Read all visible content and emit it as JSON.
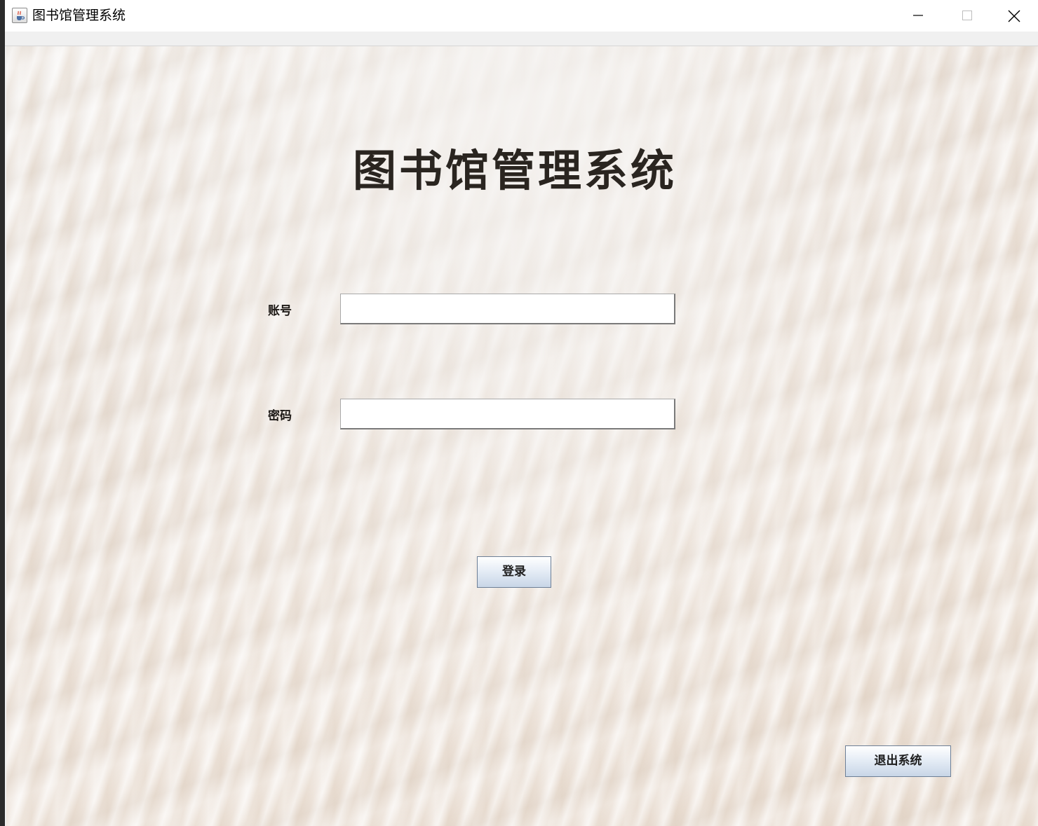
{
  "window": {
    "title": "图书馆管理系统",
    "icon": "java-cup-icon",
    "controls": [
      "minimize-icon",
      "maximize-icon",
      "close-icon"
    ]
  },
  "main": {
    "heading": "图书馆管理系统",
    "account_label": "账号",
    "account_value": "",
    "password_label": "密码",
    "password_value": "",
    "login_label": "登录",
    "exit_label": "退出系统"
  },
  "colors": {
    "heading": "#2a2520",
    "button_border": "#6d7f96",
    "background": "#ebe3dc"
  }
}
